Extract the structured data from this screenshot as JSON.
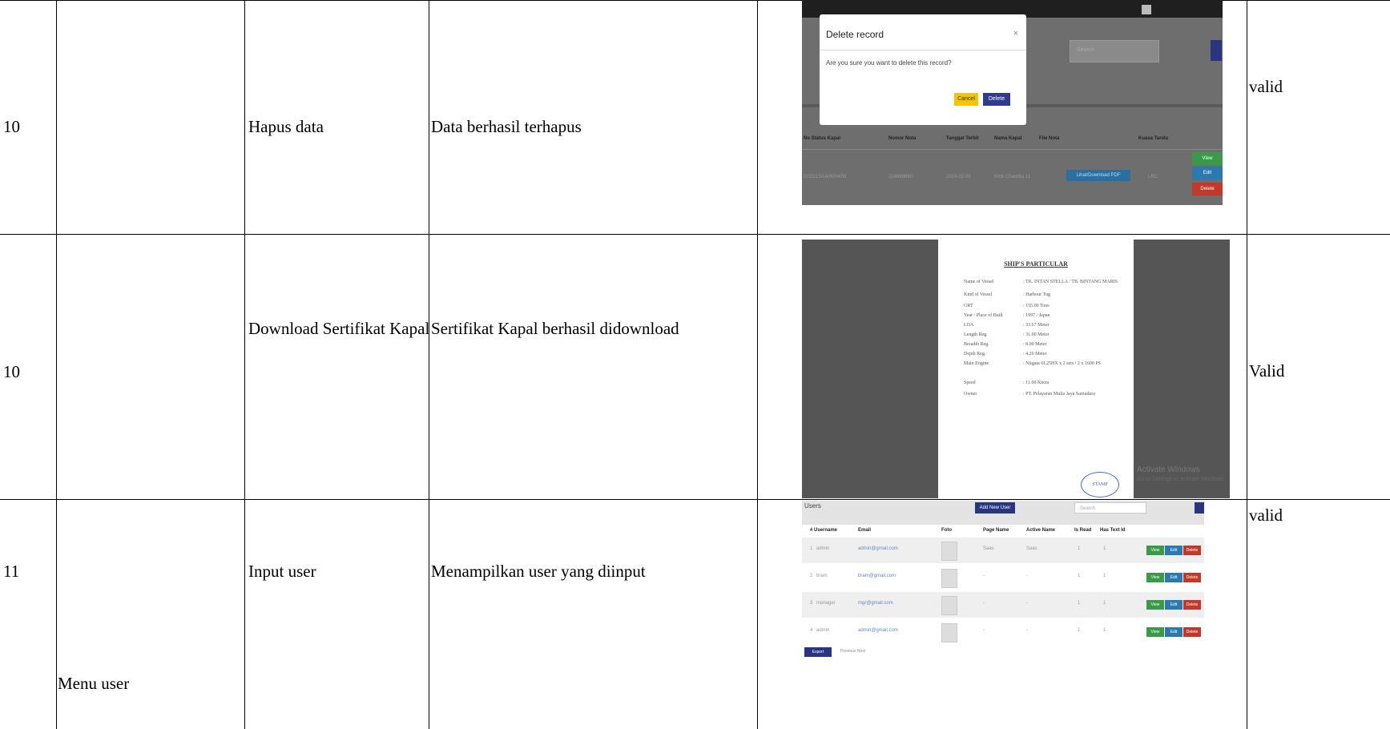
{
  "rows": [
    {
      "no": "10",
      "menu": "",
      "test": "Hapus data",
      "expected": "Data berhasil terhapus",
      "result": "valid"
    },
    {
      "no": "10",
      "menu": "",
      "test": "Download Sertifikat Kapal",
      "expected": "Sertifikat Kapal berhasil didownload",
      "result": "Valid"
    },
    {
      "no": "11",
      "menu": "Menu user",
      "test": "Input user",
      "expected": "Menampilkan user yang diinput",
      "result": "valid"
    }
  ],
  "screenshot_delete": {
    "dialog_title": "Delete record",
    "dialog_message": "Are you sure you want to delete this record?",
    "cancel_label": "Cancel",
    "delete_label": "Delete",
    "search_placeholder": "Search",
    "table_headers": [
      "No Status Kapal",
      "Nomor Nota",
      "Tanggal Terbit",
      "Nama Kapal",
      "File Nota",
      "Kuasa Tanda"
    ],
    "row_values": [
      "0132/15/14/0004/09",
      "224689890",
      "2024-02-08",
      "Kmb Chandra 11",
      "Lihat/Download PDF",
      "LRC"
    ],
    "actions": [
      "View",
      "Edit",
      "Delete"
    ],
    "colors": {
      "cancel": "#f5c400",
      "delete": "#2e3b8f"
    }
  },
  "screenshot_cert": {
    "title": "SHIP'S PARTICULAR",
    "fields": [
      {
        "label": "Name of Vessel",
        "value": ": TK. INTAN STELLA / TB. BINTANG MARIS"
      },
      {
        "label": "Kind of Vessel",
        "value": ": Harbour Tug"
      },
      {
        "label": "GRT",
        "value": ": 155.00 Tons"
      },
      {
        "label": "Year / Place of Built",
        "value": ": 1997 / Japan"
      },
      {
        "label": "LOA",
        "value": ": 33.67 Meter"
      },
      {
        "label": "Length Reg.",
        "value": ": 31.00 Meter"
      },
      {
        "label": "Breadth Reg.",
        "value": ": 8.00 Meter"
      },
      {
        "label": "Depth Reg.",
        "value": ": 4.20 Meter"
      },
      {
        "label": "Main Engine",
        "value": ": Niigata 6L25HX x 2 sets / 2 x 1600 PS"
      },
      {
        "label": "Speed",
        "value": ": 11.00 Knots"
      },
      {
        "label": "Owner",
        "value": ": PT. Pelayaran Mulia Jaya Samudera"
      }
    ],
    "stamp": "STAMP",
    "watermark_title": "Activate Windows",
    "watermark_sub": "Go to Settings to activate Windows."
  },
  "screenshot_users": {
    "title": "Users",
    "add_label": "Add New User",
    "search_placeholder": "Search",
    "headers": [
      "# Username",
      "Email",
      "Foto",
      "Page Name",
      "Active Name",
      "Is Read",
      "Has Text Id"
    ],
    "users": [
      {
        "no": "1",
        "username": "admin",
        "email": "admin@gmail.com",
        "page": "Saas",
        "active": "Saas",
        "a": "1",
        "b": "1"
      },
      {
        "no": "2",
        "username": "bram",
        "email": "bram@gmail.com",
        "page": "-",
        "active": "-",
        "a": "1",
        "b": "1"
      },
      {
        "no": "3",
        "username": "manager",
        "email": "mgr@gmail.com",
        "page": "-",
        "active": "-",
        "a": "1",
        "b": "1"
      },
      {
        "no": "4",
        "username": "admin",
        "email": "admin@gmail.com",
        "page": "-",
        "active": "-",
        "a": "1",
        "b": "1"
      }
    ],
    "actions": [
      "View",
      "Edit",
      "Delete"
    ],
    "pagination_btn": "Export",
    "pagination_label": "Previous Next"
  }
}
